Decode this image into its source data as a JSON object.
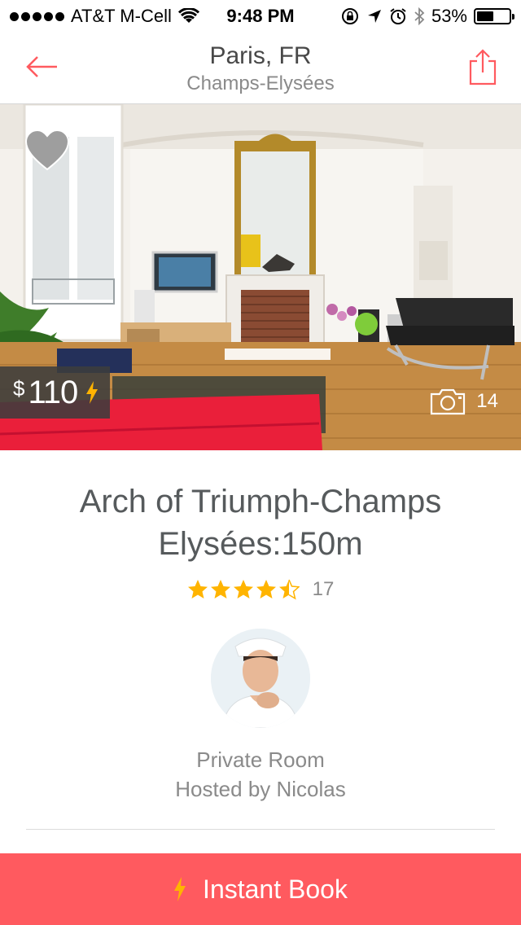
{
  "status_bar": {
    "carrier": "AT&T M-Cell",
    "time": "9:48 PM",
    "battery_percent": "53%",
    "battery_level": 0.53,
    "icons": [
      "signal-dots-icon",
      "wifi-icon",
      "lock-rotation-icon",
      "location-icon",
      "alarm-icon",
      "bluetooth-icon",
      "battery-icon"
    ]
  },
  "nav": {
    "title": "Paris, FR",
    "subtitle": "Champs-Elysées",
    "back_icon": "back-arrow-icon",
    "share_icon": "share-icon"
  },
  "hero": {
    "wishlist_icon": "heart-icon",
    "price_currency": "$",
    "price_amount": "110",
    "price_icon": "lightning-bolt-icon",
    "photo_icon": "camera-icon",
    "photo_count": "14"
  },
  "listing": {
    "title": "Arch of Triumph-Champs Elysées:150m",
    "rating": 4.5,
    "rating_max": 5,
    "review_count": "17",
    "room_type": "Private Room",
    "host": "Hosted by Nicolas"
  },
  "actions": {
    "book_label": "Instant Book",
    "book_icon": "lightning-bolt-icon"
  },
  "colors": {
    "brand": "#ff5a5f",
    "star": "#ffb400",
    "text": "#565a5c",
    "muted": "#8a8a8a"
  }
}
